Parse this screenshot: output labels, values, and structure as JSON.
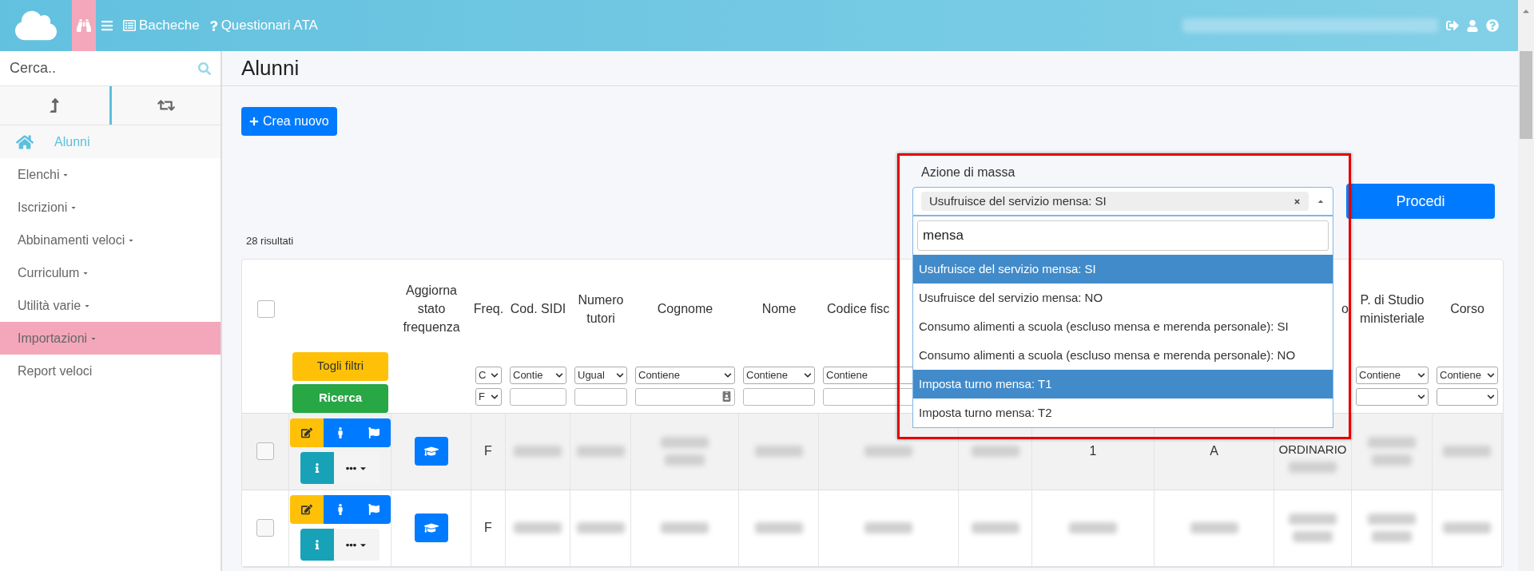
{
  "topbar": {
    "nav": [
      {
        "kind": "binoculars",
        "selected": true
      },
      {
        "kind": "menu",
        "selected": false
      },
      {
        "kind": "board",
        "label": "Bacheche",
        "selected": false
      },
      {
        "kind": "help",
        "label": "Questionari ATA",
        "selected": false
      }
    ]
  },
  "sidebar": {
    "search": {
      "placeholder": "Cerca.."
    },
    "tabs": [
      {
        "kind": "up",
        "selected": true
      },
      {
        "kind": "swap",
        "selected": false
      }
    ],
    "items": [
      {
        "label": "Alunni",
        "kind": "home",
        "selected": false
      },
      {
        "label": "Elenchi",
        "kind": "menu",
        "selected": false
      },
      {
        "label": "Iscrizioni",
        "kind": "menu",
        "selected": false
      },
      {
        "label": "Abbinamenti veloci",
        "kind": "menu",
        "selected": false
      },
      {
        "label": "Curriculum",
        "kind": "menu",
        "selected": false
      },
      {
        "label": "Utilità varie",
        "kind": "menu",
        "selected": false
      },
      {
        "label": "Importazioni",
        "kind": "menu",
        "selected": true
      },
      {
        "label": "Report veloci",
        "kind": "link",
        "selected": false
      }
    ]
  },
  "page": {
    "title": "Alunni",
    "create_button": "Crea nuovo",
    "results": "28 risultati",
    "proceed_button": "Procedi",
    "mass_action": {
      "label": "Azione di massa",
      "value": "Usufruisce del servizio mensa: SI",
      "search": "mensa",
      "options": [
        {
          "label": "Usufruisce del servizio mensa: SI",
          "highlighted": true
        },
        {
          "label": "Usufruisce del servizio mensa: NO",
          "highlighted": false
        },
        {
          "label": "Consumo alimenti a scuola (escluso mensa e merenda personale): SI",
          "highlighted": false
        },
        {
          "label": "Consumo alimenti a scuola (escluso mensa e merenda personale): NO",
          "highlighted": false
        },
        {
          "label": "Imposta turno mensa: T1",
          "highlighted": true
        },
        {
          "label": "Imposta turno mensa: T2",
          "highlighted": false
        }
      ]
    }
  },
  "table": {
    "clear_filters": "Togli filtri",
    "search_button": "Ricerca",
    "columns": [
      {
        "kind": "check",
        "checked": false
      },
      {
        "kind": "actions"
      },
      {
        "kind": "plain",
        "label": "Aggiorna stato frequenza"
      },
      {
        "kind": "plain",
        "label": "Freq.",
        "filters": [
          {
            "kind": "select",
            "value": "C"
          },
          {
            "kind": "select",
            "value": "F"
          }
        ]
      },
      {
        "kind": "plain",
        "label": "Cod. SIDI",
        "filters": [
          {
            "kind": "select",
            "value": "Contie"
          },
          {
            "kind": "input"
          }
        ]
      },
      {
        "kind": "plain",
        "label": "Numero tutori",
        "filters": [
          {
            "kind": "select",
            "value": "Ugual"
          },
          {
            "kind": "input"
          }
        ]
      },
      {
        "kind": "plain",
        "label": "Cognome",
        "filters": [
          {
            "kind": "select",
            "value": "Contiene"
          },
          {
            "kind": "card_input"
          }
        ]
      },
      {
        "kind": "plain",
        "label": "Nome",
        "filters": [
          {
            "kind": "select",
            "value": "Contiene"
          },
          {
            "kind": "input"
          }
        ]
      },
      {
        "kind": "plain",
        "label": "Codice fisc",
        "filters": [
          {
            "kind": "select",
            "value": "Contiene"
          },
          {
            "kind": "input"
          }
        ]
      },
      {
        "kind": "plain"
      },
      {
        "kind": "plain"
      },
      {
        "kind": "plain"
      },
      {
        "kind": "plain",
        "label": "o"
      },
      {
        "kind": "plain",
        "label": "P. di Studio ministeriale",
        "filters": [
          {
            "kind": "select",
            "value": "Contiene"
          },
          {
            "kind": "select"
          }
        ]
      },
      {
        "kind": "plain",
        "label": "Corso",
        "filters": [
          {
            "kind": "select",
            "value": "Contiene"
          },
          {
            "kind": "select"
          }
        ]
      }
    ],
    "rows": [
      {
        "cells": [
          {
            "kind": "check",
            "checked": false
          },
          {
            "kind": "actions"
          },
          {
            "kind": "status"
          },
          {
            "kind": "text",
            "text": "F"
          },
          {
            "kind": "redacted"
          },
          {
            "kind": "redacted"
          },
          {
            "kind": "redacted2"
          },
          {
            "kind": "redacted"
          },
          {
            "kind": "redacted"
          },
          {
            "kind": "redacted"
          },
          {
            "kind": "text",
            "text": "1"
          },
          {
            "kind": "text",
            "text": "A"
          },
          {
            "kind": "text_redacted",
            "text": "ORDINARIO"
          },
          {
            "kind": "redacted2"
          },
          {
            "kind": "redacted"
          }
        ]
      },
      {
        "cells": [
          {
            "kind": "check",
            "checked": false
          },
          {
            "kind": "actions"
          },
          {
            "kind": "status"
          },
          {
            "kind": "text",
            "text": "F"
          },
          {
            "kind": "redacted"
          },
          {
            "kind": "redacted"
          },
          {
            "kind": "redacted"
          },
          {
            "kind": "redacted"
          },
          {
            "kind": "redacted"
          },
          {
            "kind": "redacted"
          },
          {
            "kind": "redacted"
          },
          {
            "kind": "redacted"
          },
          {
            "kind": "redacted2"
          },
          {
            "kind": "redacted2"
          },
          {
            "kind": "redacted"
          }
        ]
      }
    ]
  }
}
